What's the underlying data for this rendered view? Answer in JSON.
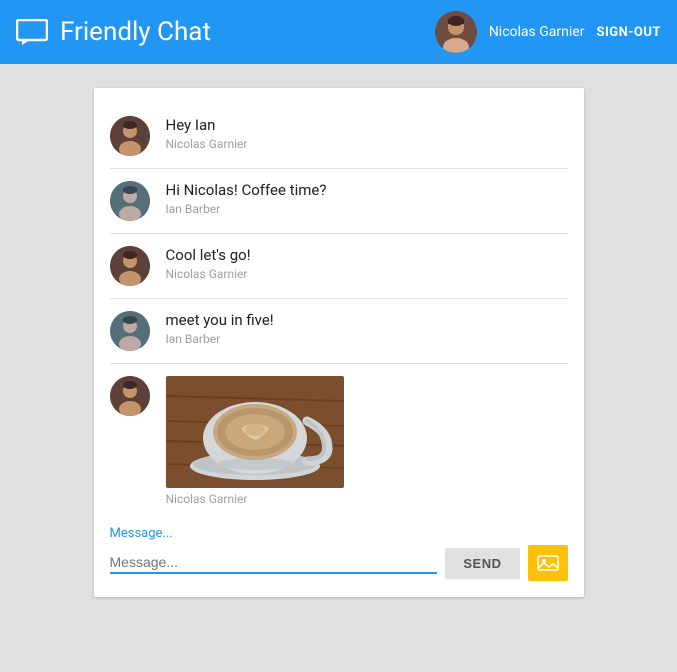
{
  "header": {
    "title": "Friendly Chat",
    "icon_label": "chat-icon",
    "user_name": "Nicolas Garnier",
    "sign_out_label": "SIGN-OUT"
  },
  "chat": {
    "messages": [
      {
        "id": 1,
        "text": "Hey Ian",
        "sender": "Nicolas Garnier",
        "avatar_type": "nicolas"
      },
      {
        "id": 2,
        "text": "Hi Nicolas! Coffee time?",
        "sender": "Ian Barber",
        "avatar_type": "ian"
      },
      {
        "id": 3,
        "text": "Cool let's go!",
        "sender": "Nicolas Garnier",
        "avatar_type": "nicolas"
      },
      {
        "id": 4,
        "text": "meet you in five!",
        "sender": "Ian Barber",
        "avatar_type": "ian"
      },
      {
        "id": 5,
        "text": "",
        "sender": "Nicolas Garnier",
        "avatar_type": "nicolas",
        "has_image": true
      }
    ]
  },
  "input": {
    "placeholder": "Message...",
    "send_label": "SEND",
    "image_button_label": "image-upload-icon"
  }
}
